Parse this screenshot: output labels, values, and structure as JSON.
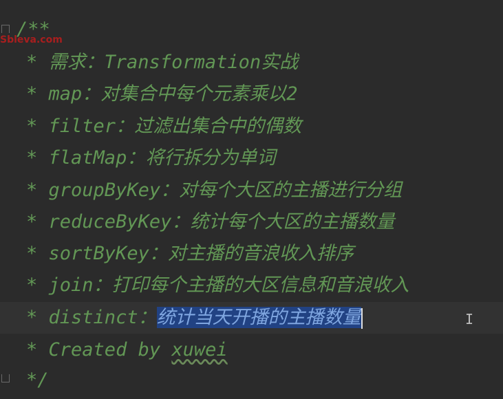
{
  "watermark": "Sbleva.com",
  "comment": {
    "open": "/**",
    "close": "*/",
    "lines": [
      {
        "prefix": "*",
        "text": "需求：Transformation实战"
      },
      {
        "prefix": "*",
        "text": "map：对集合中每个元素乘以2"
      },
      {
        "prefix": "*",
        "text": "filter：过滤出集合中的偶数"
      },
      {
        "prefix": "*",
        "text": "flatMap：将行拆分为单词"
      },
      {
        "prefix": "*",
        "text": "groupByKey：对每个大区的主播进行分组"
      },
      {
        "prefix": "*",
        "text": "reduceByKey：统计每个大区的主播数量"
      },
      {
        "prefix": "*",
        "text": "sortByKey：对主播的音浪收入排序"
      },
      {
        "prefix": "*",
        "text": "join：打印每个主播的大区信息和音浪收入"
      }
    ],
    "current_line": {
      "prefix": "*",
      "label": "distinct：",
      "selected_text": "统计当天开播的主播数量"
    },
    "author_line": {
      "prefix": "*",
      "label": "Created by",
      "author": "xuwei"
    }
  },
  "cursor_glyph": "I"
}
